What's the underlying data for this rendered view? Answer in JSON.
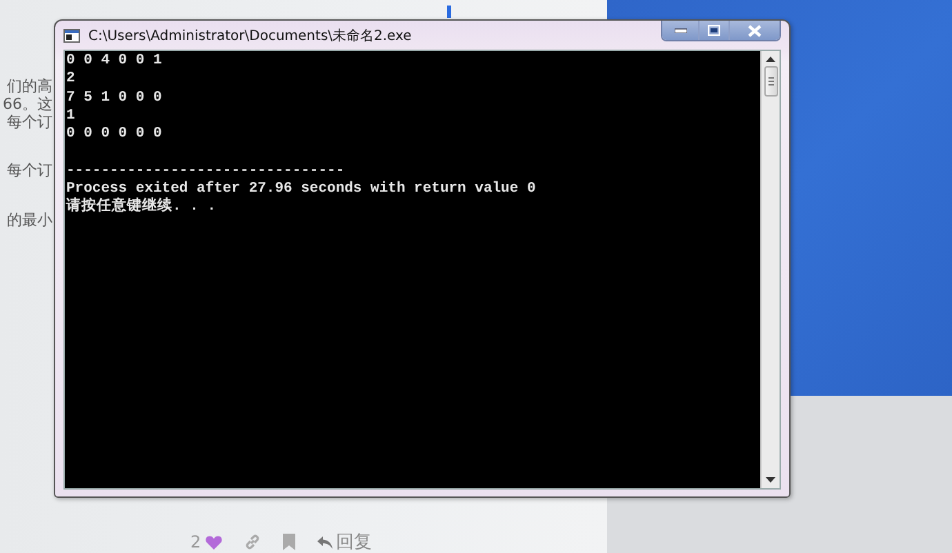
{
  "background_page": {
    "text_lines": [
      "们的高",
      "66。这",
      "每个订",
      "每个订",
      "的最小"
    ],
    "post_actions": {
      "like_count": "2",
      "liked": true,
      "reply": "回复"
    }
  },
  "window": {
    "title": "C:\\Users\\Administrator\\Documents\\未命名2.exe",
    "program_output": [
      "0 0 4 0 0 1",
      "2",
      "7 5 1 0 0 0",
      "1",
      "0 0 0 0 0 0"
    ],
    "separator": "--------------------------------",
    "exit_message": "Process exited after 27.96 seconds with return value 0",
    "prompt": "请按任意键继续. . ."
  }
}
